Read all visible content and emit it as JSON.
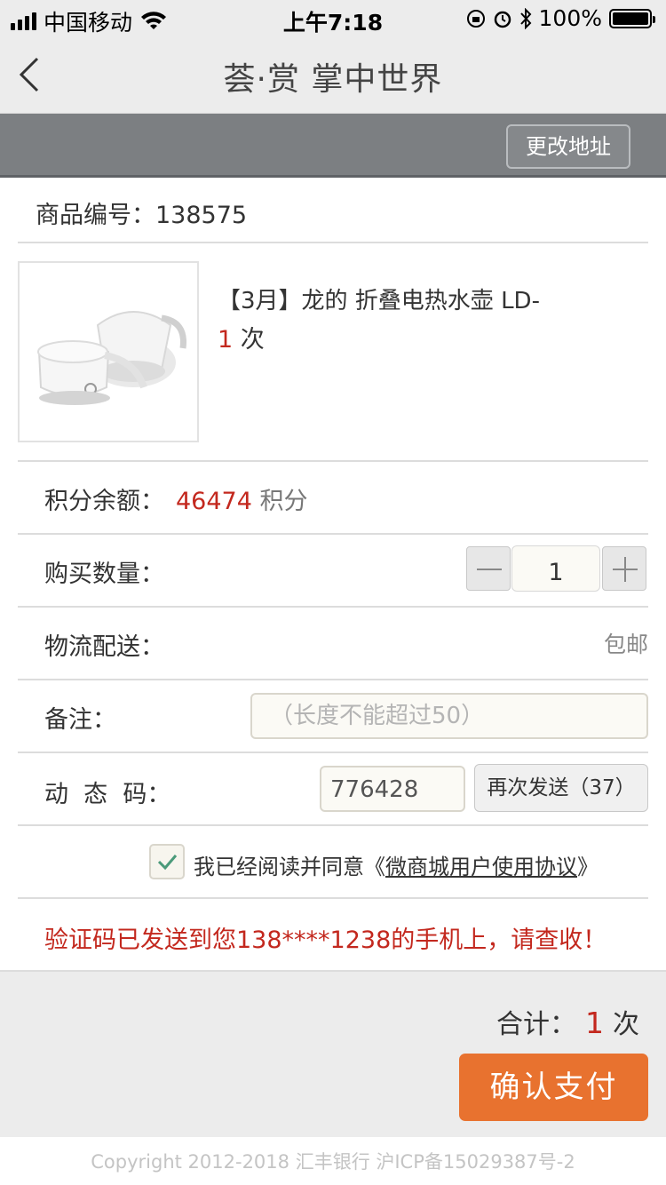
{
  "status_bar": {
    "carrier": "中国移动",
    "time": "上午7:18",
    "battery": "100%"
  },
  "nav": {
    "title": "荟·赏 掌中世界"
  },
  "address_bar": {
    "change_address_label": "更改地址"
  },
  "product": {
    "id_label": "商品编号：",
    "id_value": "138575",
    "title": "【3月】龙的 折叠电热水壶 LD-",
    "count_value": "1",
    "count_unit": " 次"
  },
  "points": {
    "label": "积分余额：",
    "value": "46474",
    "unit": " 积分"
  },
  "quantity": {
    "label": "购买数量：",
    "value": "1"
  },
  "shipping": {
    "label": "物流配送：",
    "value": "包邮"
  },
  "remark": {
    "label": "备注：",
    "placeholder": "（长度不能超过50）"
  },
  "dynamic_code": {
    "label": "动  态  码：",
    "value": "776428",
    "resend_label": "再次发送（37）"
  },
  "agreement": {
    "checked": true,
    "prefix": "我已经阅读并同意《",
    "link_text": "微商城用户使用协议",
    "suffix": "》"
  },
  "verify_message": "验证码已发送到您138****1238的手机上，请查收！",
  "total": {
    "label": "合计：",
    "value": "1",
    "unit": "次"
  },
  "pay_button_label": "确认支付",
  "copyright": "Copyright 2012-2018 汇丰银行 沪ICP备15029387号-2",
  "colors": {
    "accent": "#e8722f",
    "highlight_red": "#c3281e",
    "address_bar": "#7c7f82"
  }
}
